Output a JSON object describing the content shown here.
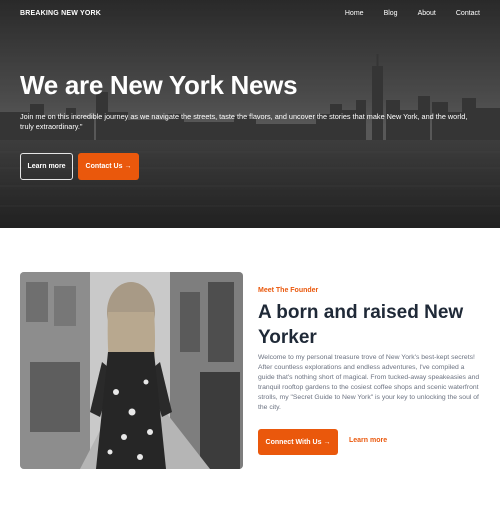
{
  "header": {
    "brand": "BREAKING NEW YORK",
    "nav": [
      "Home",
      "Blog",
      "About",
      "Contact"
    ]
  },
  "hero": {
    "title": "We are New York News",
    "description": "Join me on this incredible journey as we navigate the streets, taste the flavors, and uncover the stories that make New York, and the world, truly extraordinary.\"",
    "learn_more": "Learn more",
    "contact": "Contact Us",
    "arrow": "→"
  },
  "founder": {
    "eyebrow": "Meet The Founder",
    "title": "A born and raised New Yorker",
    "description": "Welcome to my personal treasure trove of New York's best-kept secrets! After countless explorations and endless adventures, I've compiled a guide that's nothing short of magical. From tucked-away speakeasies and tranquil rooftop gardens to the cosiest coffee shops and scenic waterfront strolls, my \"Secret Guide to New York\" is your key to unlocking the soul of the city.",
    "connect": "Connect With Us",
    "arrow": "→",
    "learn_more": "Learn more"
  },
  "colors": {
    "accent": "#ea580c",
    "heading": "#1f2937",
    "body": "#6b7280"
  },
  "icons": [
    "arrow-right-icon"
  ],
  "images": [
    "new-york-skyline-photo",
    "woman-walking-street-photo"
  ]
}
